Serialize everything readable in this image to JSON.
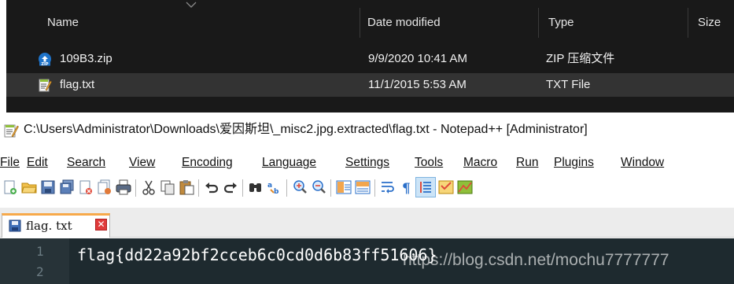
{
  "explorer": {
    "columns": {
      "name": "Name",
      "date_modified": "Date modified",
      "type": "Type",
      "size": "Size"
    },
    "files": [
      {
        "name": "109B3.zip",
        "date_modified": "9/9/2020 10:41 AM",
        "type": "ZIP 压缩文件",
        "icon": "zip-icon"
      },
      {
        "name": "flag.txt",
        "date_modified": "11/1/2015 5:53 AM",
        "type": "TXT File",
        "icon": "text-file-icon"
      }
    ]
  },
  "notepad": {
    "title": "C:\\Users\\Administrator\\Downloads\\爱因斯坦\\_misc2.jpg.extracted\\flag.txt - Notepad++ [Administrator]",
    "menu": [
      "File",
      "Edit",
      "Search",
      "View",
      "Encoding",
      "Language",
      "Settings",
      "Tools",
      "Macro",
      "Run",
      "Plugins",
      "Window"
    ],
    "tab": {
      "label": "flag. txt",
      "close": "✕"
    },
    "lines": [
      "1",
      "2"
    ],
    "content": "flag{dd22a92bf2cceb6c0cd0d6b83ff51606}",
    "watermark": "https://blog.csdn.net/mochu7777777"
  },
  "colors": {
    "explorer_bg": "#191919",
    "selected_row": "#333333",
    "editor_bg": "#1e2a2f",
    "tab_accent": "#f7a94a"
  }
}
